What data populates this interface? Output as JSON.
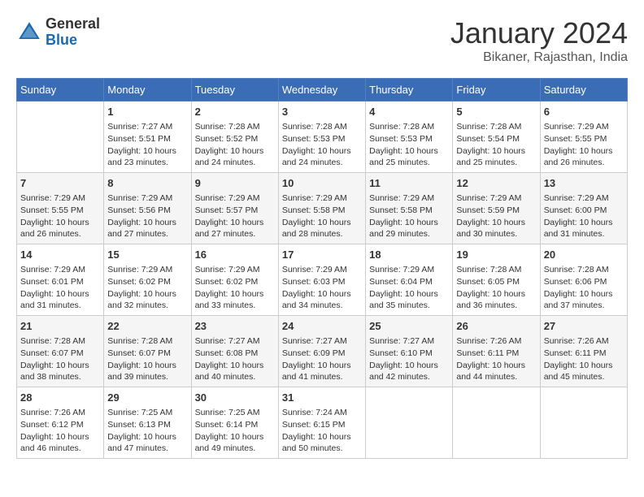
{
  "header": {
    "logo_general": "General",
    "logo_blue": "Blue",
    "title": "January 2024",
    "subtitle": "Bikaner, Rajasthan, India"
  },
  "days_of_week": [
    "Sunday",
    "Monday",
    "Tuesday",
    "Wednesday",
    "Thursday",
    "Friday",
    "Saturday"
  ],
  "weeks": [
    [
      {
        "day": "",
        "content": ""
      },
      {
        "day": "1",
        "content": "Sunrise: 7:27 AM\nSunset: 5:51 PM\nDaylight: 10 hours\nand 23 minutes."
      },
      {
        "day": "2",
        "content": "Sunrise: 7:28 AM\nSunset: 5:52 PM\nDaylight: 10 hours\nand 24 minutes."
      },
      {
        "day": "3",
        "content": "Sunrise: 7:28 AM\nSunset: 5:53 PM\nDaylight: 10 hours\nand 24 minutes."
      },
      {
        "day": "4",
        "content": "Sunrise: 7:28 AM\nSunset: 5:53 PM\nDaylight: 10 hours\nand 25 minutes."
      },
      {
        "day": "5",
        "content": "Sunrise: 7:28 AM\nSunset: 5:54 PM\nDaylight: 10 hours\nand 25 minutes."
      },
      {
        "day": "6",
        "content": "Sunrise: 7:29 AM\nSunset: 5:55 PM\nDaylight: 10 hours\nand 26 minutes."
      }
    ],
    [
      {
        "day": "7",
        "content": "Sunrise: 7:29 AM\nSunset: 5:55 PM\nDaylight: 10 hours\nand 26 minutes."
      },
      {
        "day": "8",
        "content": "Sunrise: 7:29 AM\nSunset: 5:56 PM\nDaylight: 10 hours\nand 27 minutes."
      },
      {
        "day": "9",
        "content": "Sunrise: 7:29 AM\nSunset: 5:57 PM\nDaylight: 10 hours\nand 27 minutes."
      },
      {
        "day": "10",
        "content": "Sunrise: 7:29 AM\nSunset: 5:58 PM\nDaylight: 10 hours\nand 28 minutes."
      },
      {
        "day": "11",
        "content": "Sunrise: 7:29 AM\nSunset: 5:58 PM\nDaylight: 10 hours\nand 29 minutes."
      },
      {
        "day": "12",
        "content": "Sunrise: 7:29 AM\nSunset: 5:59 PM\nDaylight: 10 hours\nand 30 minutes."
      },
      {
        "day": "13",
        "content": "Sunrise: 7:29 AM\nSunset: 6:00 PM\nDaylight: 10 hours\nand 31 minutes."
      }
    ],
    [
      {
        "day": "14",
        "content": "Sunrise: 7:29 AM\nSunset: 6:01 PM\nDaylight: 10 hours\nand 31 minutes."
      },
      {
        "day": "15",
        "content": "Sunrise: 7:29 AM\nSunset: 6:02 PM\nDaylight: 10 hours\nand 32 minutes."
      },
      {
        "day": "16",
        "content": "Sunrise: 7:29 AM\nSunset: 6:02 PM\nDaylight: 10 hours\nand 33 minutes."
      },
      {
        "day": "17",
        "content": "Sunrise: 7:29 AM\nSunset: 6:03 PM\nDaylight: 10 hours\nand 34 minutes."
      },
      {
        "day": "18",
        "content": "Sunrise: 7:29 AM\nSunset: 6:04 PM\nDaylight: 10 hours\nand 35 minutes."
      },
      {
        "day": "19",
        "content": "Sunrise: 7:28 AM\nSunset: 6:05 PM\nDaylight: 10 hours\nand 36 minutes."
      },
      {
        "day": "20",
        "content": "Sunrise: 7:28 AM\nSunset: 6:06 PM\nDaylight: 10 hours\nand 37 minutes."
      }
    ],
    [
      {
        "day": "21",
        "content": "Sunrise: 7:28 AM\nSunset: 6:07 PM\nDaylight: 10 hours\nand 38 minutes."
      },
      {
        "day": "22",
        "content": "Sunrise: 7:28 AM\nSunset: 6:07 PM\nDaylight: 10 hours\nand 39 minutes."
      },
      {
        "day": "23",
        "content": "Sunrise: 7:27 AM\nSunset: 6:08 PM\nDaylight: 10 hours\nand 40 minutes."
      },
      {
        "day": "24",
        "content": "Sunrise: 7:27 AM\nSunset: 6:09 PM\nDaylight: 10 hours\nand 41 minutes."
      },
      {
        "day": "25",
        "content": "Sunrise: 7:27 AM\nSunset: 6:10 PM\nDaylight: 10 hours\nand 42 minutes."
      },
      {
        "day": "26",
        "content": "Sunrise: 7:26 AM\nSunset: 6:11 PM\nDaylight: 10 hours\nand 44 minutes."
      },
      {
        "day": "27",
        "content": "Sunrise: 7:26 AM\nSunset: 6:11 PM\nDaylight: 10 hours\nand 45 minutes."
      }
    ],
    [
      {
        "day": "28",
        "content": "Sunrise: 7:26 AM\nSunset: 6:12 PM\nDaylight: 10 hours\nand 46 minutes."
      },
      {
        "day": "29",
        "content": "Sunrise: 7:25 AM\nSunset: 6:13 PM\nDaylight: 10 hours\nand 47 minutes."
      },
      {
        "day": "30",
        "content": "Sunrise: 7:25 AM\nSunset: 6:14 PM\nDaylight: 10 hours\nand 49 minutes."
      },
      {
        "day": "31",
        "content": "Sunrise: 7:24 AM\nSunset: 6:15 PM\nDaylight: 10 hours\nand 50 minutes."
      },
      {
        "day": "",
        "content": ""
      },
      {
        "day": "",
        "content": ""
      },
      {
        "day": "",
        "content": ""
      }
    ]
  ]
}
